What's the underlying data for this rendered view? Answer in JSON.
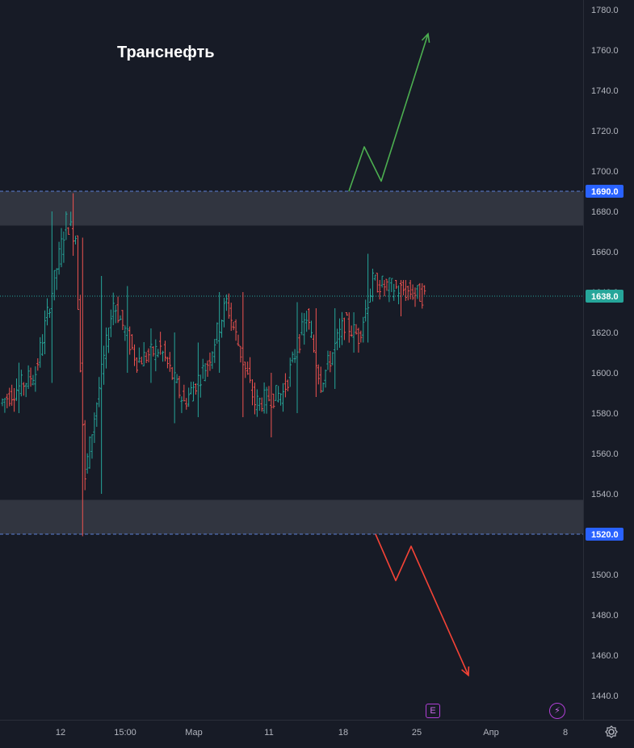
{
  "chart_data": {
    "type": "candlestick",
    "title": "Транснефть",
    "ylim": [
      1430,
      1785
    ],
    "y_ticks": [
      1440.0,
      1460.0,
      1480.0,
      1500.0,
      1520.0,
      1540.0,
      1560.0,
      1580.0,
      1600.0,
      1620.0,
      1640.0,
      1660.0,
      1680.0,
      1700.0,
      1720.0,
      1740.0,
      1760.0,
      1780.0
    ],
    "x_tick_labels": [
      "12",
      "15:00",
      "Мар",
      "11",
      "18",
      "25",
      "Апр",
      "8"
    ],
    "price_labels": [
      {
        "value": "1690.0",
        "color": "#2962ff"
      },
      {
        "value": "1638.0",
        "color": "#26a69a"
      },
      {
        "value": "1520.0",
        "color": "#2962ff"
      }
    ],
    "zones": [
      {
        "name": "resistance",
        "from": 1673,
        "to": 1690
      },
      {
        "name": "support",
        "from": 1520,
        "to": 1537
      }
    ],
    "current_price": 1638.0,
    "projections": [
      {
        "name": "bullish",
        "color": "#4caf50",
        "points": [
          [
            1,
            1690
          ],
          [
            2,
            1712
          ],
          [
            3,
            1695
          ],
          [
            4,
            1768
          ]
        ]
      },
      {
        "name": "bearish",
        "color": "#f44336",
        "points": [
          [
            1,
            1520
          ],
          [
            2,
            1497
          ],
          [
            3,
            1514
          ],
          [
            4,
            1450
          ]
        ]
      }
    ],
    "segments": [
      {
        "bars": 15,
        "start": 1585,
        "end": 1600,
        "hi": 1605,
        "lo": 1580
      },
      {
        "bars": 13,
        "start": 1600,
        "end": 1675,
        "hi": 1680,
        "lo": 1595
      },
      {
        "bars": 4,
        "start": 1675,
        "end": 1668,
        "hi": 1689,
        "lo": 1658
      },
      {
        "bars": 4,
        "start": 1665,
        "end": 1545,
        "hi": 1667,
        "lo": 1519
      },
      {
        "bars": 12,
        "start": 1550,
        "end": 1635,
        "hi": 1648,
        "lo": 1540
      },
      {
        "bars": 10,
        "start": 1635,
        "end": 1606,
        "hi": 1643,
        "lo": 1600
      },
      {
        "bars": 10,
        "start": 1606,
        "end": 1612,
        "hi": 1622,
        "lo": 1595
      },
      {
        "bars": 10,
        "start": 1612,
        "end": 1585,
        "hi": 1620,
        "lo": 1575
      },
      {
        "bars": 10,
        "start": 1585,
        "end": 1605,
        "hi": 1615,
        "lo": 1578
      },
      {
        "bars": 8,
        "start": 1605,
        "end": 1635,
        "hi": 1640,
        "lo": 1600
      },
      {
        "bars": 12,
        "start": 1635,
        "end": 1585,
        "hi": 1640,
        "lo": 1578
      },
      {
        "bars": 12,
        "start": 1585,
        "end": 1590,
        "hi": 1600,
        "lo": 1568
      },
      {
        "bars": 10,
        "start": 1590,
        "end": 1628,
        "hi": 1635,
        "lo": 1580
      },
      {
        "bars": 6,
        "start": 1628,
        "end": 1595,
        "hi": 1632,
        "lo": 1588
      },
      {
        "bars": 10,
        "start": 1595,
        "end": 1625,
        "hi": 1632,
        "lo": 1592
      },
      {
        "bars": 6,
        "start": 1625,
        "end": 1618,
        "hi": 1630,
        "lo": 1610
      },
      {
        "bars": 6,
        "start": 1618,
        "end": 1645,
        "hi": 1659,
        "lo": 1615
      },
      {
        "bars": 22,
        "start": 1645,
        "end": 1638,
        "hi": 1646,
        "lo": 1628
      }
    ]
  }
}
